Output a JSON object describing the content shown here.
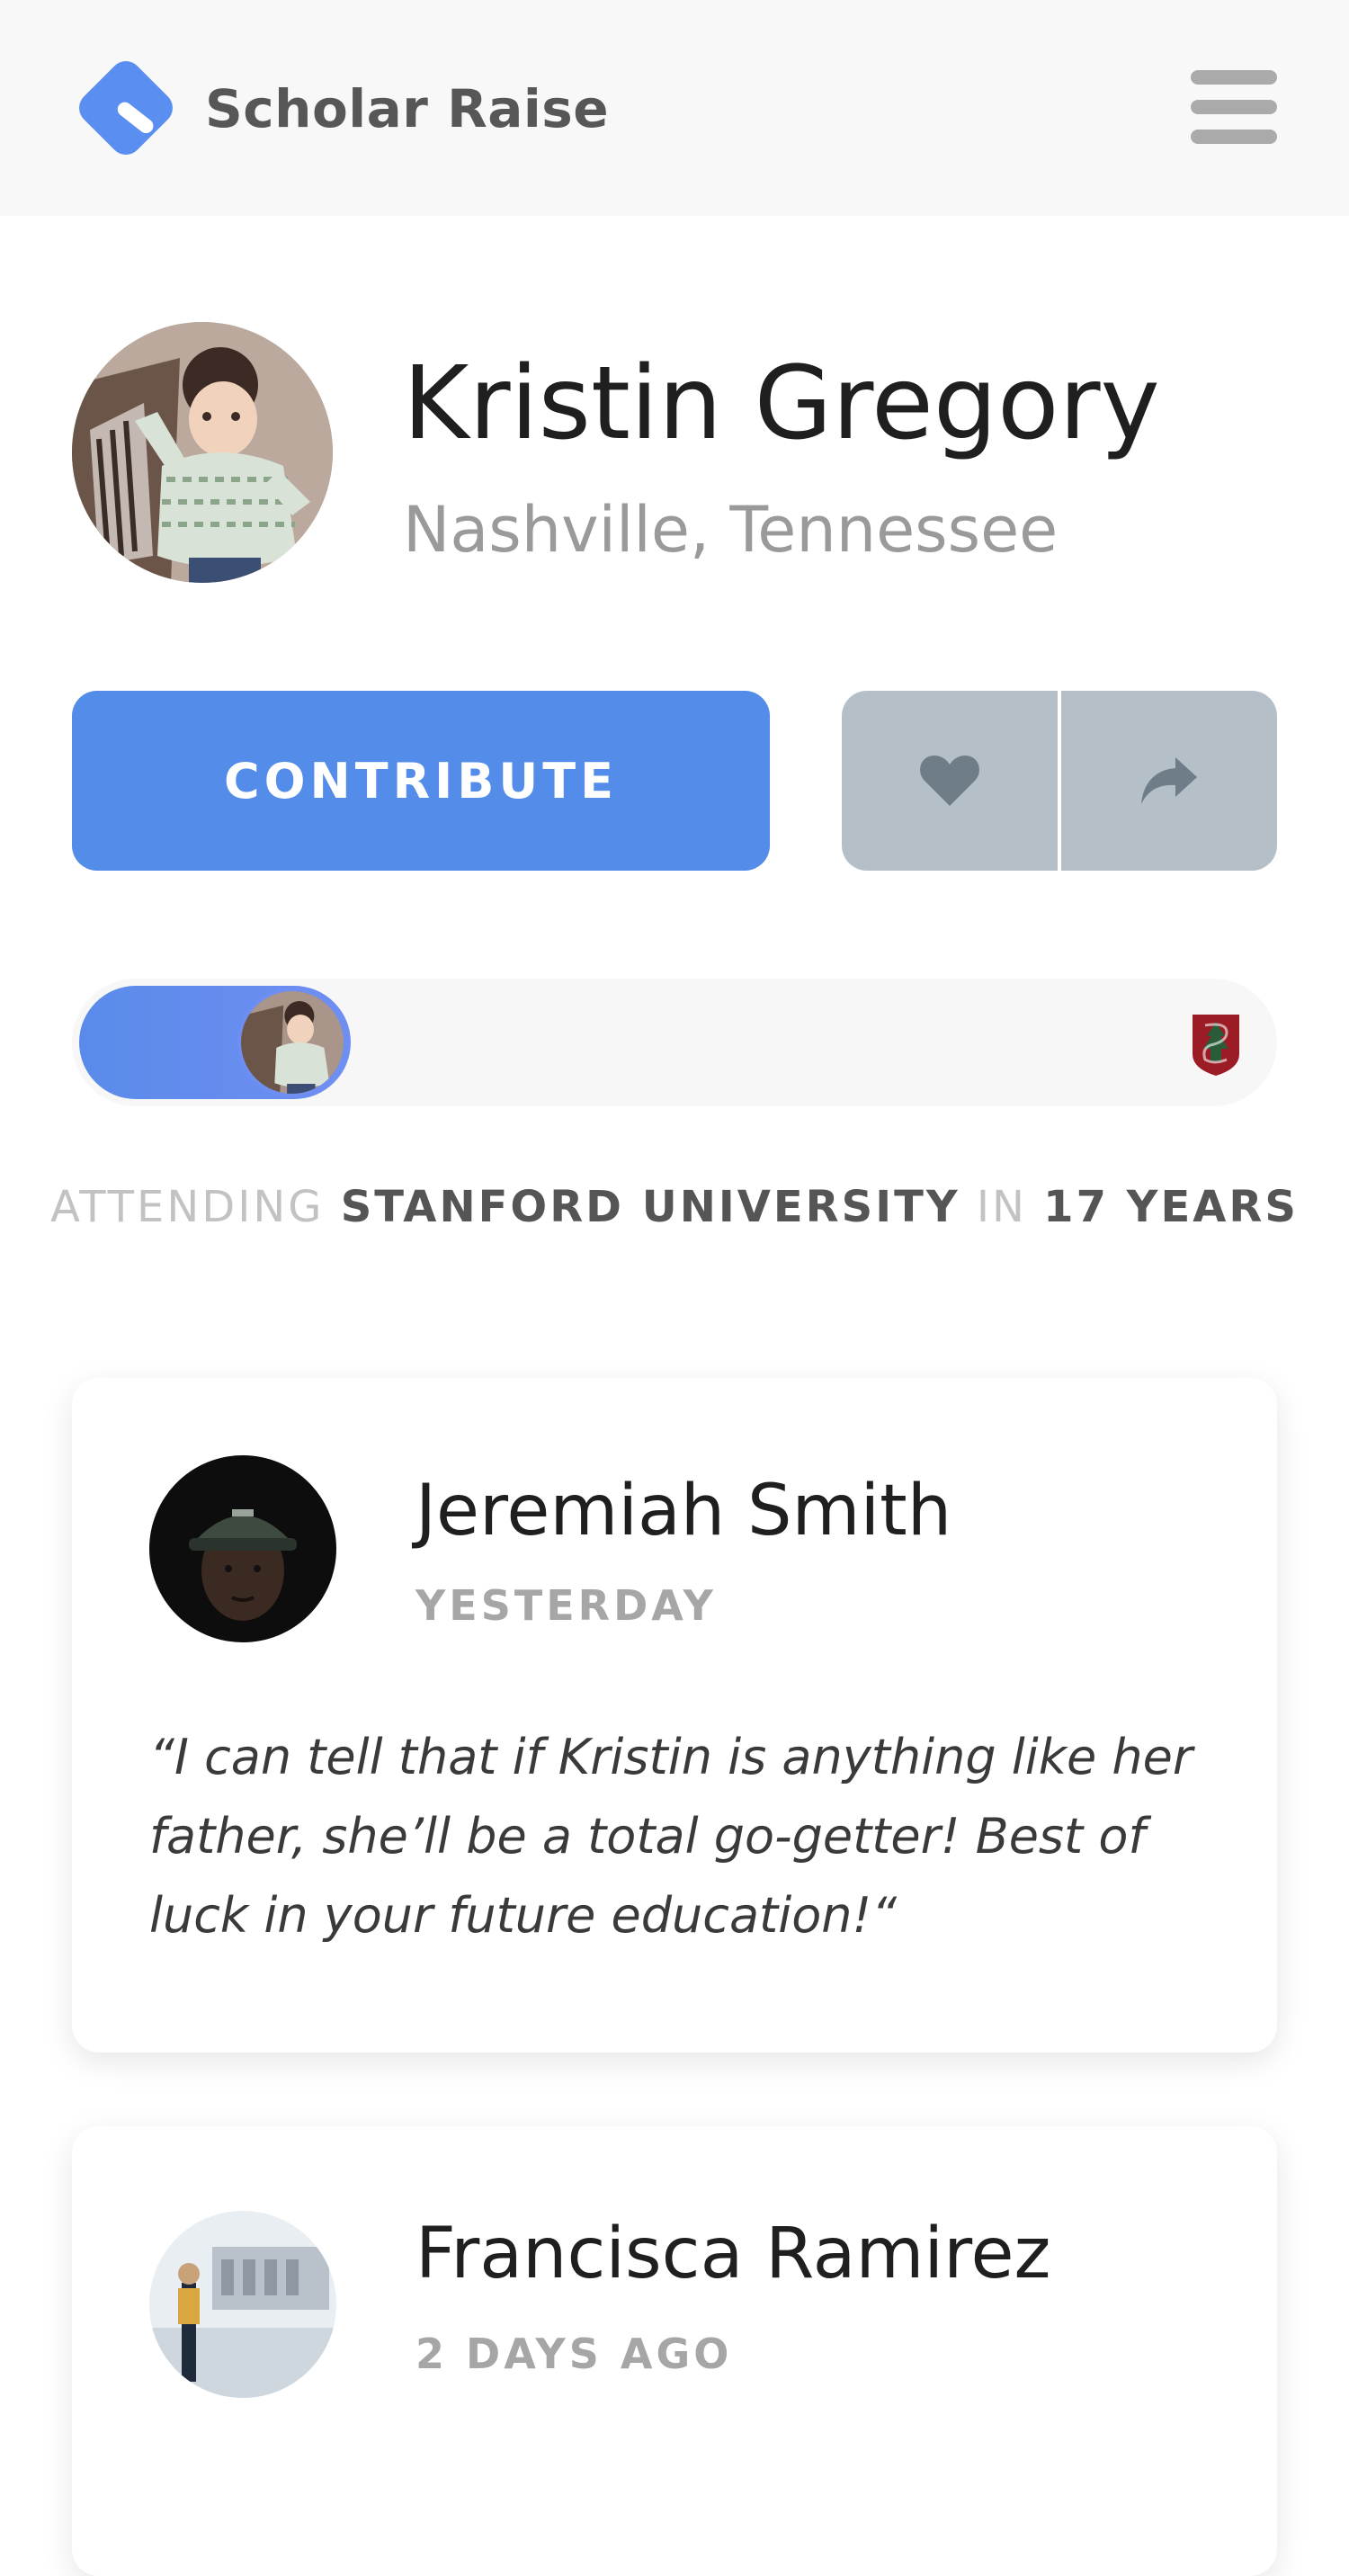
{
  "header": {
    "brand": "Scholar Raise",
    "logo_icon": "scholar-raise-logo-icon",
    "menu_icon": "hamburger-menu-icon"
  },
  "profile": {
    "name": "Kristin Gregory",
    "location": "Nashville, Tennessee",
    "avatar": "child-photo-avatar"
  },
  "actions": {
    "contribute_label": "CONTRIBUTE",
    "like_icon": "heart-icon",
    "share_icon": "share-arrow-icon"
  },
  "progress": {
    "fraction": 0.145,
    "school_icon": "stanford-logo-icon"
  },
  "attending": {
    "prefix": "ATTENDING",
    "school": "STANFORD UNIVERSITY",
    "connector": "IN",
    "duration": "17 YEARS"
  },
  "comments": [
    {
      "name": "Jeremiah Smith",
      "time": "YESTERDAY",
      "quote": "“I can tell that if Kristin is anything like her father, she’ll be a total go-getter!  Best of luck in your future education!“"
    },
    {
      "name": "Francisca Ramirez",
      "time": "2 DAYS AGO",
      "quote": ""
    }
  ],
  "colors": {
    "accent": "#548cea",
    "icon_group_bg": "#b5bfc8",
    "muted_text": "#9a9a9a"
  }
}
